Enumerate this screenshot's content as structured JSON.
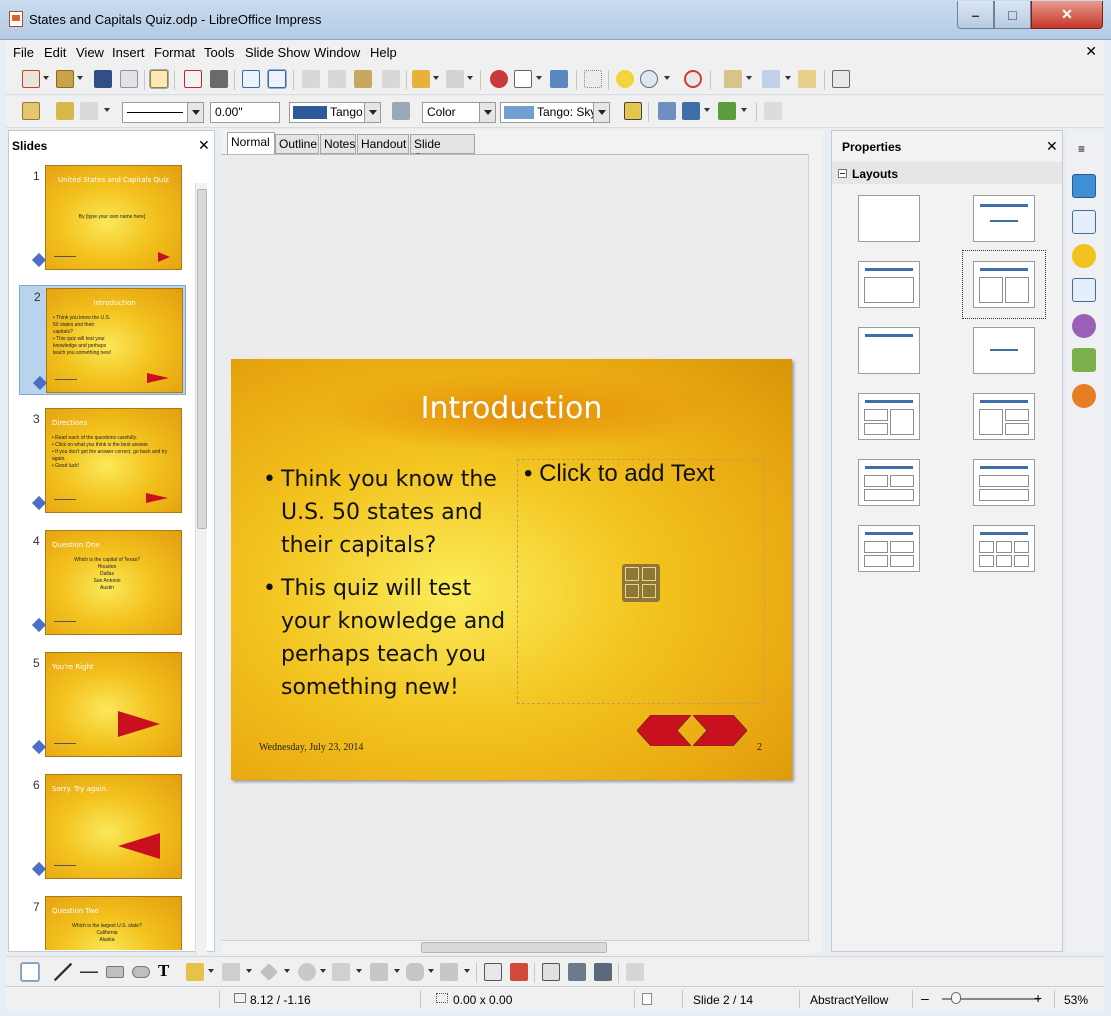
{
  "window": {
    "title": "States and Capitals Quiz.odp - LibreOffice Impress",
    "minimize": "–",
    "maximize": "□",
    "close": "✕"
  },
  "menu": {
    "items": [
      "File",
      "Edit",
      "View",
      "Insert",
      "Format",
      "Tools",
      "Slide Show",
      "Window",
      "Help"
    ],
    "close_doc": "✕"
  },
  "line_toolbar": {
    "width_value": "0.00\"",
    "line_color": "Tango",
    "fill_type": "Color",
    "fill_color": "Tango: Sky"
  },
  "slides_panel": {
    "title": "Slides",
    "close": "✕",
    "thumbnails": [
      {
        "num": "1",
        "title": "United States and Capitals Quiz",
        "body": "By [type your own name here]"
      },
      {
        "num": "2",
        "title": "Introduction",
        "body": "• Think you know the U.S. 50 states and their capitals?\n• This quiz will test your knowledge and perhaps teach you something new!"
      },
      {
        "num": "3",
        "title": "Directions",
        "body": "• Read each of the questions carefully.\n• Click on what you think is the best answer.\n• If you don't get the answer correct, go back and try again.\n• Good luck!"
      },
      {
        "num": "4",
        "title": "Question One",
        "body": "Which is the capital of Texas?\nHouston\nDallas\nSan Antonio\nAustin"
      },
      {
        "num": "5",
        "title": "You're Right",
        "body": ""
      },
      {
        "num": "6",
        "title": "Sorry.  Try again.",
        "body": ""
      },
      {
        "num": "7",
        "title": "Question Two",
        "body": "Which is the largest U.S. state?\nCalifornia\nAlaska"
      }
    ]
  },
  "view_tabs": [
    "Normal",
    "Outline",
    "Notes",
    "Handout",
    "Slide Sorter"
  ],
  "slide": {
    "title": "Introduction",
    "bullets": [
      "Think you know the U.S. 50 states and their capitals?",
      "This quiz will test your knowledge and perhaps teach you something new!"
    ],
    "placeholder_text": "• Click to add Text",
    "footer_date": "Wednesday, July 23, 2014",
    "slide_number": "2"
  },
  "properties": {
    "title": "Properties",
    "close": "✕",
    "section": "Layouts"
  },
  "statusbar": {
    "position": "8.12 / -1.16",
    "size": "0.00 x 0.00",
    "slide": "Slide 2 / 14",
    "master": "AbstractYellow",
    "zoom_minus": "–",
    "zoom_plus": "+",
    "zoom": "53%"
  },
  "colors": {
    "accent_blue": "#3d6fa6",
    "slide_yellow": "#f3c41f",
    "arrow_red": "#c8101e"
  }
}
